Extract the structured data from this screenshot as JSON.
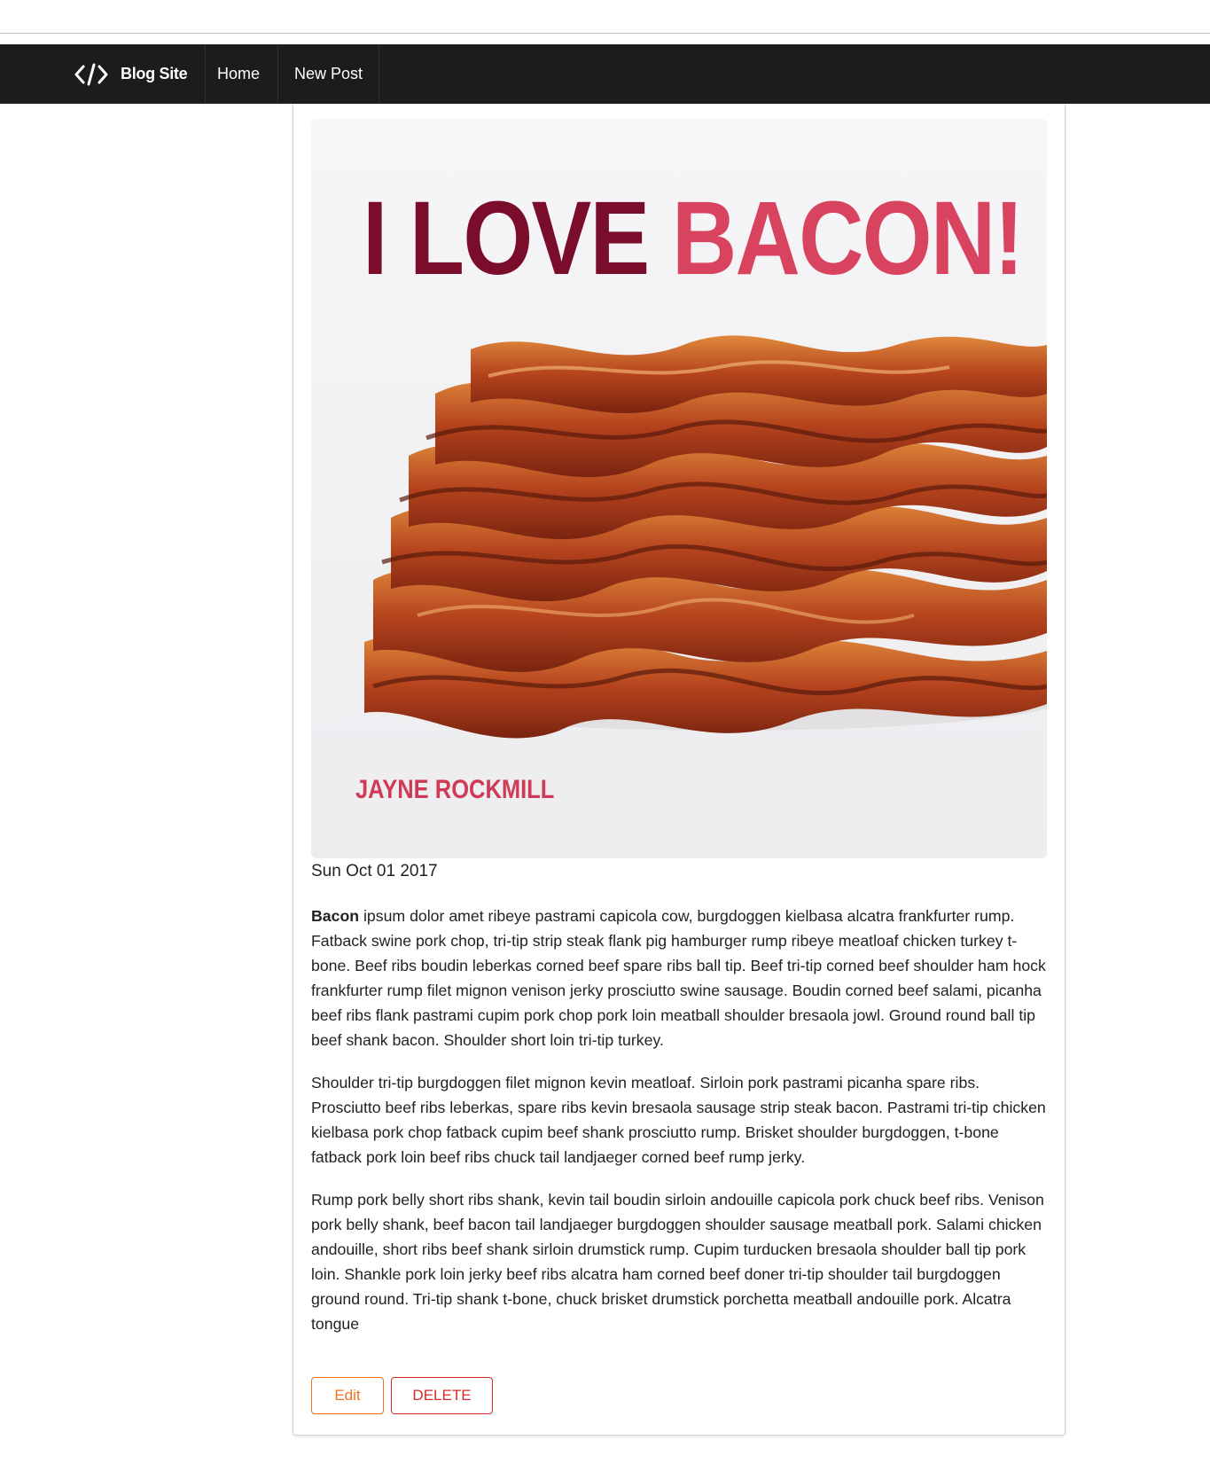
{
  "navbar": {
    "brand_label": "Blog Site",
    "brand_icon": "code-icon",
    "home_label": "Home",
    "new_post_label": "New Post",
    "background": "#1b1c1d"
  },
  "post": {
    "cover": {
      "title_part1": "I LOVE",
      "title_part2": "BACON!",
      "author": "JAYNE ROCKMILL",
      "title_color_dark": "#7a0d2c",
      "title_color_accent": "#d8445f"
    },
    "date": "Sun Oct 01 2017",
    "body_lead": "Bacon",
    "paragraph1": " ipsum dolor amet ribeye pastrami capicola cow, burgdoggen kielbasa alcatra frankfurter rump. Fatback swine pork chop, tri-tip strip steak flank pig hamburger rump ribeye meatloaf chicken turkey t-bone. Beef ribs boudin leberkas corned beef spare ribs ball tip. Beef tri-tip corned beef shoulder ham hock frankfurter rump filet mignon venison jerky prosciutto swine sausage. Boudin corned beef salami, picanha beef ribs flank pastrami cupim pork chop pork loin meatball shoulder bresaola jowl. Ground round ball tip beef shank bacon. Shoulder short loin tri-tip turkey.",
    "paragraph2": "Shoulder tri-tip burgdoggen filet mignon kevin meatloaf. Sirloin pork pastrami picanha spare ribs. Prosciutto beef ribs leberkas, spare ribs kevin bresaola sausage strip steak bacon. Pastrami tri-tip chicken kielbasa pork chop fatback cupim beef shank prosciutto rump. Brisket shoulder burgdoggen, t-bone fatback pork loin beef ribs chuck tail landjaeger corned beef rump jerky.",
    "paragraph3": "Rump pork belly short ribs shank, kevin tail boudin sirloin andouille capicola pork chuck beef ribs. Venison pork belly shank, beef bacon tail landjaeger burgdoggen shoulder sausage meatball pork. Salami chicken andouille, short ribs beef shank sirloin drumstick rump. Cupim turducken bresaola shoulder ball tip pork loin. Shankle pork loin jerky beef ribs alcatra ham corned beef doner tri-tip shoulder tail burgdoggen ground round. Tri-tip shank t-bone, chuck brisket drumstick porchetta meatball andouille pork. Alcatra tongue"
  },
  "actions": {
    "edit_label": "Edit",
    "delete_label": "DELETE",
    "edit_color": "#f2711c",
    "delete_color": "#db2828"
  }
}
